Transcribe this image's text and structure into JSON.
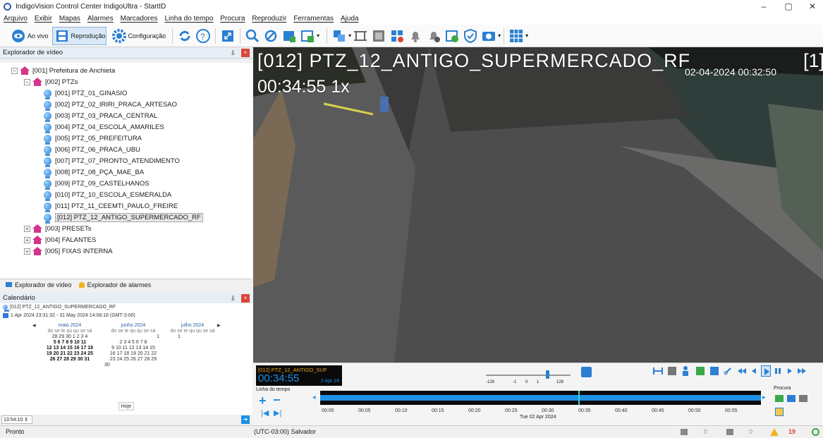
{
  "window": {
    "title": "IndigoVision Control Center IndigoUltra - StartID",
    "minimize": "–",
    "maximize": "▢",
    "close": "✕"
  },
  "menu": [
    "Arquivo",
    "Exibir",
    "Mapas",
    "Alarmes",
    "Marcadores",
    "Linha do tempo",
    "Procura",
    "Reproduzir",
    "Ferramentas",
    "Ajuda"
  ],
  "toolbar": {
    "live": "Ao vivo",
    "playback": "Reprodução",
    "config": "Configuração"
  },
  "explorer": {
    "title": "Explorador de vídeo",
    "pin": "⇩",
    "close": "×",
    "root": "[001] Prefeitura de Anchieta",
    "group": "[002] PTZs",
    "cameras": [
      "[001] PTZ_01_GINASIO",
      "[002] PTZ_02_IRIRI_PRACA_ARTESAO",
      "[003] PTZ_03_PRACA_CENTRAL",
      "[004] PTZ_04_ESCOLA_AMARILES",
      "[005] PTZ_05_PREFEITURA",
      "[006] PTZ_06_PRACA_UBU",
      "[007] PTZ_07_PRONTO_ATENDIMENTO",
      "[008] PTZ_08_PÇA_MAE_BA",
      "[009] PTZ_09_CASTELHANOS",
      "[010] PTZ_10_ESCOLA_ESMERALDA",
      "[011] PTZ_11_CEEMTI_PAULO_FREIRE",
      "[012] PTZ_12_ANTIGO_SUPERMERCADO_RF"
    ],
    "others": [
      "[003] PRESETs",
      "[004] FALANTES",
      "[005] FIXAS INTERNA"
    ]
  },
  "tabs": {
    "video": "Explorador de vídeo",
    "alarms": "Explorador de alarmes"
  },
  "calendar": {
    "title": "Calendário",
    "camera": "[012] PTZ_12_ANTIGO_SUPERMERCADO_RF",
    "range": "1 Apr 2024 23:31:32 - 31 May 2024 14:08:16 (GMT-3:00)",
    "months": [
      {
        "name": "maio 2024",
        "days": "do se te qu qu se sá",
        "rows": [
          "28 29 30 1 2 3 4",
          "5 6 7 8 9 10 11",
          "12 13 14 15 16 17 18",
          "19 20 21 22 23 24 25",
          "26 27 28 29 30 31"
        ]
      },
      {
        "name": "junho 2024",
        "days": "do se te qu qu se sá",
        "rows": [
          "1",
          "2 3 4 5 6 7 8",
          "9 10 11 12 13 14 15",
          "16 17 18 19 20 21 22",
          "23 24 25 26 27 28 29",
          "30"
        ]
      },
      {
        "name": "julho 2024",
        "days": "do se te qu qu se sá",
        "rows": [
          "1"
        ]
      }
    ],
    "today": "Hoje",
    "time": "13:54:10 ⇕"
  },
  "status": {
    "left": "Pronto",
    "tz": "(UTC-03:00) Salvador",
    "count_a": "0",
    "count_b": "0",
    "count_c": "19"
  },
  "video": {
    "camera_title": "[012] PTZ_12_ANTIGO_SUPERMERCADO_RF",
    "tile": "[1]",
    "time": "00:34:55",
    "speed": "1x",
    "timestamp": "02-04-2024 00:32:50"
  },
  "playback": {
    "cam": "[012] PTZ_12_ANTIGO_SUF",
    "time": "00:34:55",
    "date": "2 Apr 24",
    "scale": [
      "-128",
      "-1",
      "0",
      "1",
      "128"
    ],
    "timeline_label": "Linha do tempo",
    "ticks": [
      "00:00",
      "00:05",
      "00:10",
      "00:15",
      "00:20",
      "00:25",
      "00:30",
      "00:35",
      "00:40",
      "00:45",
      "00:50",
      "00:55"
    ],
    "day": "Tue 02 Apr 2024",
    "search": "Procura"
  },
  "colors": {
    "accent": "#1e8fe6",
    "overlay_bg": "#0a0a0a",
    "time_orange": "#f2a21b"
  }
}
